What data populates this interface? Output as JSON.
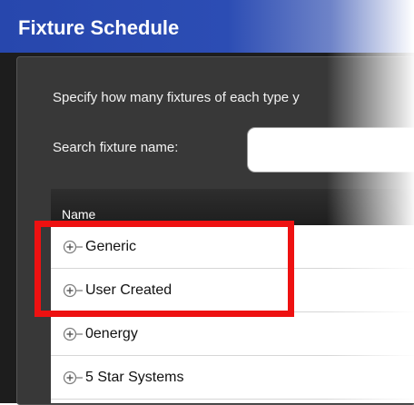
{
  "window": {
    "title": "Fixture Schedule"
  },
  "instruction": "Specify how many fixtures of each type y",
  "search": {
    "label": "Search fixture name:",
    "value": "",
    "placeholder": ""
  },
  "tree": {
    "column_header": "Name",
    "expander_icon": "plus-tree-expander-icon",
    "items": [
      {
        "label": "Generic"
      },
      {
        "label": "User Created"
      },
      {
        "label": "0energy"
      },
      {
        "label": "5 Star Systems"
      }
    ]
  },
  "highlight": {
    "color": "#ee1111"
  },
  "colors": {
    "title_bar": "#2c4db4",
    "panel": "#383838",
    "window": "#1d1d1d",
    "tree_background": "#ffffff"
  }
}
